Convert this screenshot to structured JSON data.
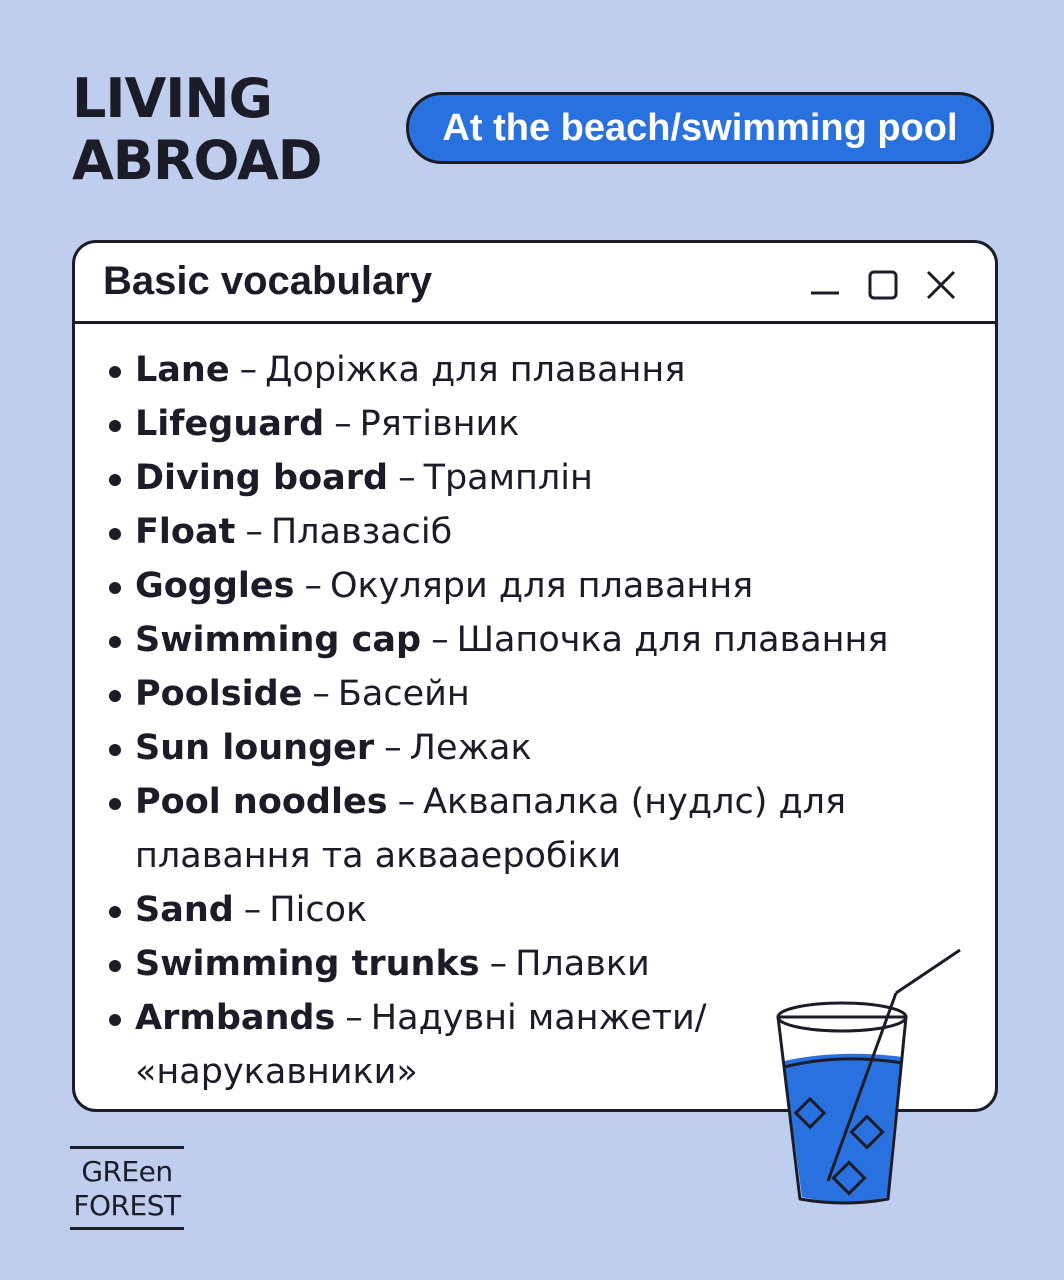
{
  "header": {
    "title_line1": "LIVING",
    "title_line2": "ABROAD",
    "topic": "At the beach/swimming pool"
  },
  "window": {
    "title": "Basic vocabulary",
    "controls": [
      "minimize-icon",
      "maximize-icon",
      "close-icon"
    ]
  },
  "vocabulary": [
    {
      "term": "Lane",
      "translation": "Доріжка для плавання"
    },
    {
      "term": "Lifeguard",
      "translation": "Рятівник"
    },
    {
      "term": "Diving board",
      "translation": "Трамплін"
    },
    {
      "term": "Float",
      "translation": "Плавзасіб"
    },
    {
      "term": "Goggles",
      "translation": "Окуляри для плавання"
    },
    {
      "term": "Swimming cap",
      "translation": "Шапочка для плавання"
    },
    {
      "term": "Poolside",
      "translation": "Басейн"
    },
    {
      "term": "Sun lounger",
      "translation": "Лежак"
    },
    {
      "term": "Pool noodles",
      "translation": "Аквапалка (нудлс) для плавання та аквааеробіки"
    },
    {
      "term": "Sand",
      "translation": "Пісок"
    },
    {
      "term": "Swimming trunks",
      "translation": "Плавки"
    },
    {
      "term": "Armbands",
      "translation": "Надувні манжети/ «нарукавники»"
    }
  ],
  "logo": {
    "line1": "GREen",
    "line2": "FOREST"
  },
  "colors": {
    "background": "#bfcdee",
    "accent": "#2871de",
    "ink": "#1c1c28"
  }
}
